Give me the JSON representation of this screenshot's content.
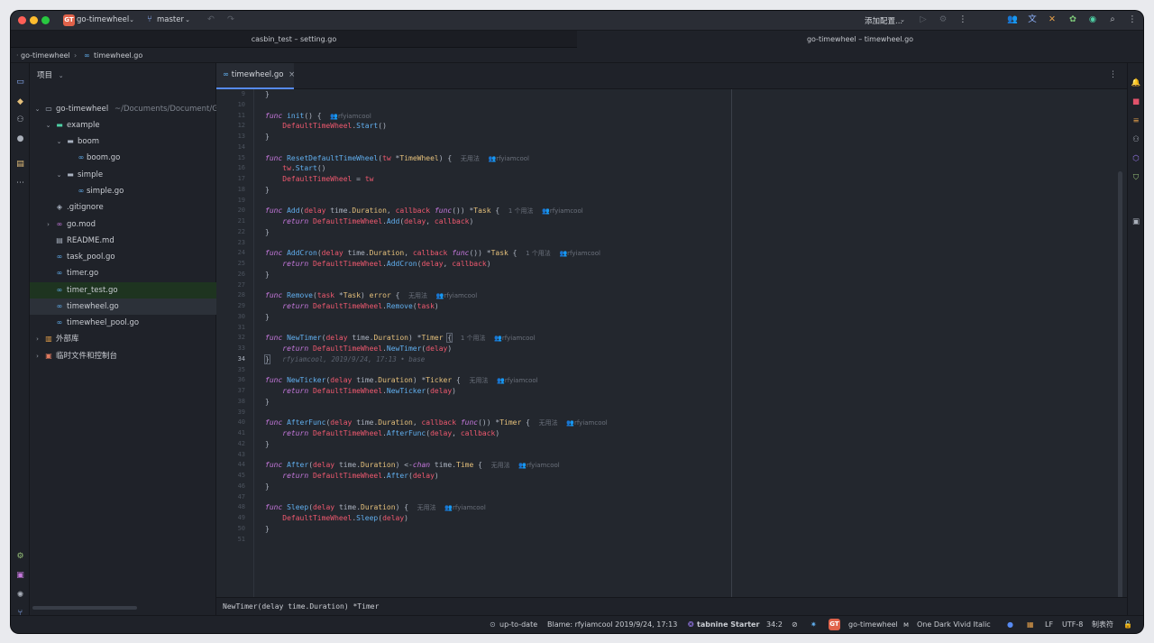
{
  "titlebar": {
    "project_badge": "GT",
    "project": "go-timewheel",
    "branch": "master",
    "add_config": "添加配置..."
  },
  "window_tabs": [
    "casbin_test – setting.go",
    "go-timewheel – timewheel.go"
  ],
  "breadcrumb": [
    "go-timewheel",
    "timewheel.go"
  ],
  "project_panel": {
    "title": "项目",
    "root_hint": "~/Documents/Document/Git",
    "items": [
      {
        "label": "go-timewheel"
      },
      {
        "label": "example"
      },
      {
        "label": "boom"
      },
      {
        "label": "boom.go"
      },
      {
        "label": "simple"
      },
      {
        "label": "simple.go"
      },
      {
        "label": ".gitignore"
      },
      {
        "label": "go.mod"
      },
      {
        "label": "README.md"
      },
      {
        "label": "task_pool.go"
      },
      {
        "label": "timer.go"
      },
      {
        "label": "timer_test.go"
      },
      {
        "label": "timewheel.go"
      },
      {
        "label": "timewheel_pool.go"
      },
      {
        "label": "外部库"
      },
      {
        "label": "临时文件和控制台"
      }
    ]
  },
  "editor": {
    "tab": "timewheel.go",
    "signature": "NewTimer(delay time.Duration) *Timer",
    "blame_inline": "rfyiamcool, 2019/9/24, 17:13 • base",
    "line_numbers": [
      "9",
      "10",
      "11",
      "12",
      "13",
      "14",
      "15",
      "16",
      "17",
      "18",
      "19",
      "20",
      "21",
      "22",
      "23",
      "24",
      "25",
      "26",
      "27",
      "28",
      "29",
      "30",
      "31",
      "32",
      "33",
      "34",
      "35",
      "36",
      "37",
      "38",
      "39",
      "40",
      "41",
      "42",
      "43",
      "44",
      "45",
      "46",
      "47",
      "48",
      "49",
      "50",
      "51"
    ],
    "current_line": "34",
    "author": "rfyiamcool",
    "no_usages": "无用法",
    "one_usage": "1 个用法"
  },
  "status": {
    "vcs": "up-to-date",
    "blame": "Blame: rfyiamcool 2019/9/24, 17:13",
    "tabnine": "tabnine Starter",
    "position": "34:2",
    "project_badge": "GT",
    "project": "go-timewheel",
    "theme": "One Dark Vivid Italic",
    "line_sep": "LF",
    "encoding": "UTF-8",
    "indent": "制表符"
  },
  "colors": {
    "accent": "#568af2",
    "keyword": "#c678dd",
    "function": "#61afef",
    "type": "#e5c07b",
    "param": "#ef596f"
  }
}
